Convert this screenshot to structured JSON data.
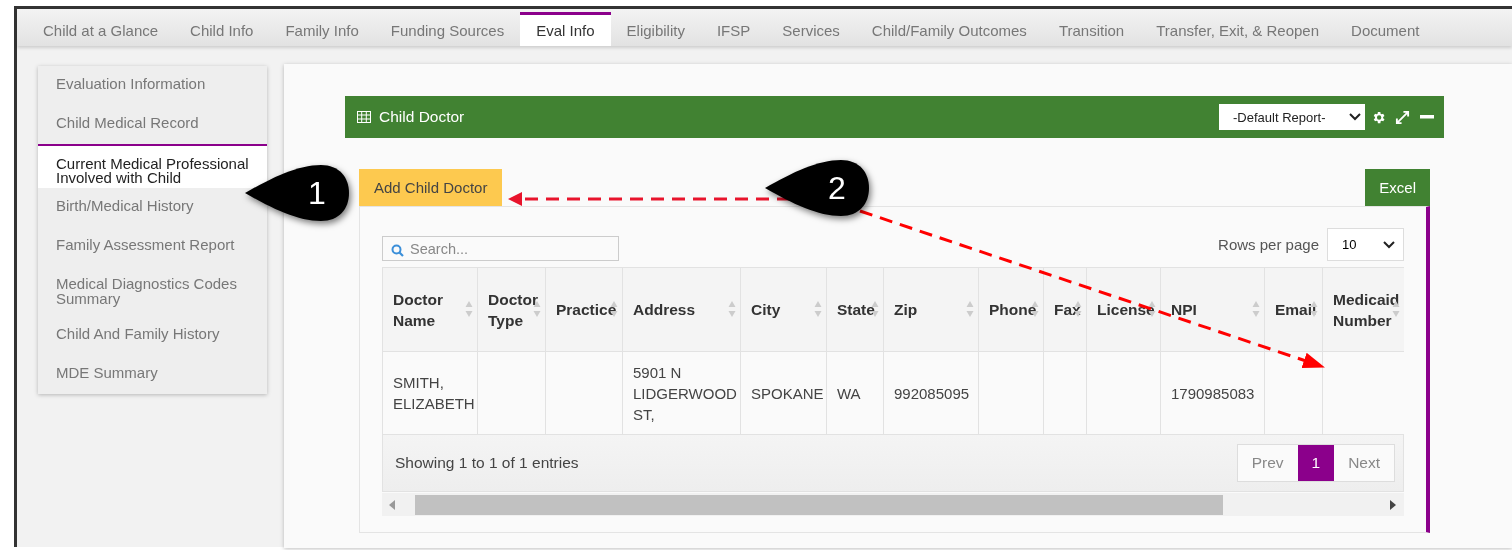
{
  "tabs": [
    {
      "label": "Child at a Glance",
      "selected": false
    },
    {
      "label": "Child Info",
      "selected": false
    },
    {
      "label": "Family Info",
      "selected": false
    },
    {
      "label": "Funding Sources",
      "selected": false
    },
    {
      "label": "Eval Info",
      "selected": true
    },
    {
      "label": "Eligibility",
      "selected": false
    },
    {
      "label": "IFSP",
      "selected": false
    },
    {
      "label": "Services",
      "selected": false
    },
    {
      "label": "Child/Family Outcomes",
      "selected": false
    },
    {
      "label": "Transition",
      "selected": false
    },
    {
      "label": "Transfer, Exit, & Reopen",
      "selected": false
    },
    {
      "label": "Document",
      "selected": false
    }
  ],
  "sidebar": {
    "items": [
      {
        "label": "Evaluation Information",
        "selected": false
      },
      {
        "label": "Child Medical Record",
        "selected": false
      },
      {
        "label": "Current Medical Professional Involved with Child",
        "selected": true
      },
      {
        "label": "Birth/Medical History",
        "selected": false
      },
      {
        "label": "Family Assessment Report",
        "selected": false
      },
      {
        "label": "Medical Diagnostics Codes Summary",
        "selected": false
      },
      {
        "label": "Child And Family History",
        "selected": false
      },
      {
        "label": "MDE Summary",
        "selected": false
      }
    ]
  },
  "panel": {
    "title": "Child Doctor",
    "report_select": "-Default Report-"
  },
  "buttons": {
    "add": "Add Child Doctor",
    "excel": "Excel"
  },
  "search": {
    "placeholder": "Search..."
  },
  "rows_per_page": {
    "label": "Rows per page",
    "value": "10"
  },
  "table": {
    "columns": [
      "Doctor Name",
      "Doctor Type",
      "Practice",
      "Address",
      "City",
      "State",
      "Zip",
      "Phone",
      "Fax",
      "License",
      "NPI",
      "Email",
      "Medicaid Number"
    ],
    "rows": [
      [
        "SMITH, ELIZABETH",
        "",
        "",
        "5901 N LIDGERWOOD ST,",
        "SPOKANE",
        "WA",
        "992085095",
        "",
        "",
        "",
        "1790985083",
        "",
        ""
      ]
    ]
  },
  "footer": {
    "info": "Showing 1 to 1 of 1 entries",
    "prev": "Prev",
    "pages": [
      {
        "label": "1",
        "selected": true
      }
    ],
    "next": "Next"
  },
  "callouts": [
    {
      "label": "1"
    },
    {
      "label": "2"
    }
  ]
}
